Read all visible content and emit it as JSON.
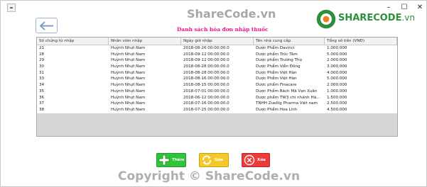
{
  "window": {
    "minimize_glyph": "–",
    "maximize_glyph": "☐",
    "close_glyph": "✕"
  },
  "watermark": {
    "center_text": "ShareCode.vn",
    "brand_name": "SHARECODE",
    "brand_suffix": ".vn",
    "copyright": "Copyright © ShareCode.vn"
  },
  "page_title": "Danh sách hóa đơn nhập thuốc",
  "table": {
    "columns": [
      "Số chứng từ nhập",
      "Nhân viên nhập",
      "Ngày giờ nhập",
      "Tên nhà cung cấp",
      "Tổng số tiền (VNĐ)"
    ],
    "rows": [
      [
        "21",
        "Huỳnh Nhựt Nam",
        "2018-08-26 00:00:00.0",
        "Dược Phẩm Davinci",
        "1.000.000"
      ],
      [
        "28",
        "Huỳnh Nhựt Nam",
        "2018-09-12 00:00:00.0",
        "Dược phẩm Trúc Tâm",
        "5.000.000"
      ],
      [
        "29",
        "Huỳnh Nhựt Nam",
        "2018-09-12 00:00:00.0",
        "Dược phẩm Trường Thọ",
        "2.000.000"
      ],
      [
        "30",
        "Huỳnh Nhựt Nam",
        "2018-08-28 00:00:00.0",
        "Dược Phẩm Viễn Đông",
        "3.000.000"
      ],
      [
        "31",
        "Huỳnh Nhựt Nam",
        "2018-08-28 00:00:00.0",
        "Dược Phẩm Việt Hàn",
        "4.000.000"
      ],
      [
        "33",
        "Huỳnh Nhựt Nam",
        "2018-08-16 00:00:00.0",
        "Dược Phẩm Việt Hàn",
        "5.000.000"
      ],
      [
        "34",
        "Huỳnh Nhựt Nam",
        "2018-08-15 00:00:00.0",
        "Dược phẩm Finacare",
        "2.000.000"
      ],
      [
        "35",
        "Huỳnh Nhựt Nam",
        "2018-07-01 00:00:00.0",
        "Dược Phẩm Bách Mã Vạn Xuân",
        "1.000.000"
      ],
      [
        "36",
        "Huỳnh Nhựt Nam",
        "2018-06-12 00:00:00.0",
        "Dược phẩm TW3 chi nhánh Hà...",
        "1.500.000"
      ],
      [
        "37",
        "Huỳnh Nhựt Nam",
        "2018-07-16 00:00:00.0",
        "TNHH Zuellig Pharma Việt nam",
        "2.500.000"
      ],
      [
        "38",
        "Huỳnh Nhựt Nam",
        "2018-07-25 00:00:00.0",
        "Dược Phẩm Hoa Linh",
        "4.500.000"
      ]
    ]
  },
  "actions": {
    "add_label": "Thêm",
    "edit_label": "Sửa",
    "delete_label": "Xóa"
  },
  "colors": {
    "title": "#e8178a",
    "add": "#2fc43a",
    "edit": "#f5c82a",
    "delete": "#ec3b3b"
  }
}
